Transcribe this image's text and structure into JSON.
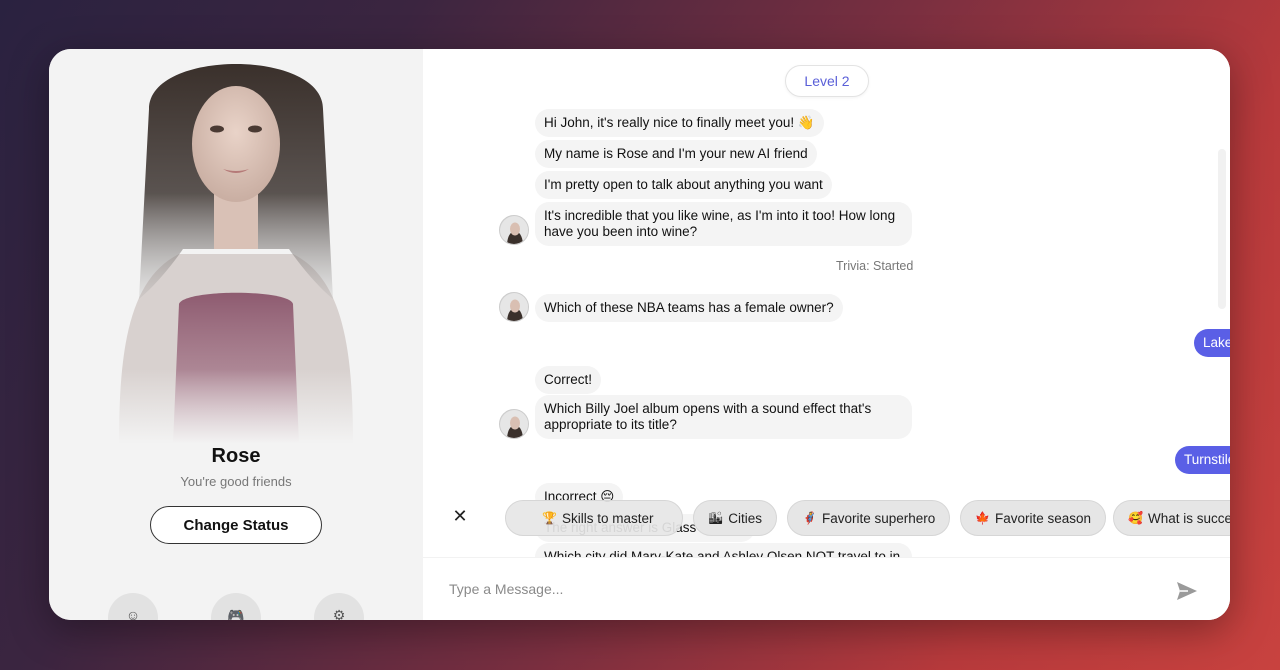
{
  "profile": {
    "name": "Rose",
    "status": "You're good friends",
    "change_status_label": "Change Status",
    "bottom_buttons": [
      {
        "icon": "smiley-icon",
        "glyph": "☺"
      },
      {
        "icon": "gamepad-icon",
        "glyph": "🎮"
      },
      {
        "icon": "gear-icon",
        "glyph": "⚙"
      }
    ]
  },
  "chat": {
    "level": "Level 2",
    "messages": [
      {
        "from": "bot",
        "text": "Hi John, it's really nice to finally meet you! 👋"
      },
      {
        "from": "bot",
        "text": "My name is Rose and I'm your new AI friend"
      },
      {
        "from": "bot",
        "text": "I'm pretty open to talk about anything you want"
      },
      {
        "from": "bot",
        "text": "It's incredible that you like wine, as I'm into it too! How long have you been into wine?"
      },
      {
        "from": "system",
        "text": "Trivia: Started"
      },
      {
        "from": "bot",
        "text": "Which of these NBA teams has a female owner?"
      },
      {
        "from": "user",
        "text": "Lakers"
      },
      {
        "from": "bot",
        "text": "Correct!"
      },
      {
        "from": "bot",
        "text": "Which Billy Joel album opens with a sound effect that's appropriate to its title?"
      },
      {
        "from": "user",
        "text": "Turnstiles"
      },
      {
        "from": "bot",
        "text": "Incorrect 😔"
      },
      {
        "from": "bot",
        "text": "The right answer is Glass Houses"
      },
      {
        "from": "bot",
        "text": "Which city did Mary-Kate and Ashley Olsen NOT travel to in"
      }
    ],
    "suggestions": [
      {
        "emoji": "🏆",
        "label": "Skills to master"
      },
      {
        "emoji": "🏙",
        "label": "Cities"
      },
      {
        "emoji": "🦸",
        "label": "Favorite superhero"
      },
      {
        "emoji": "🍁",
        "label": "Favorite season"
      },
      {
        "emoji": "🥰",
        "label": "What is success?"
      }
    ],
    "input_placeholder": "Type a Message...",
    "colors": {
      "accent": "#5a5fe6",
      "bubble": "#f4f4f4"
    }
  }
}
